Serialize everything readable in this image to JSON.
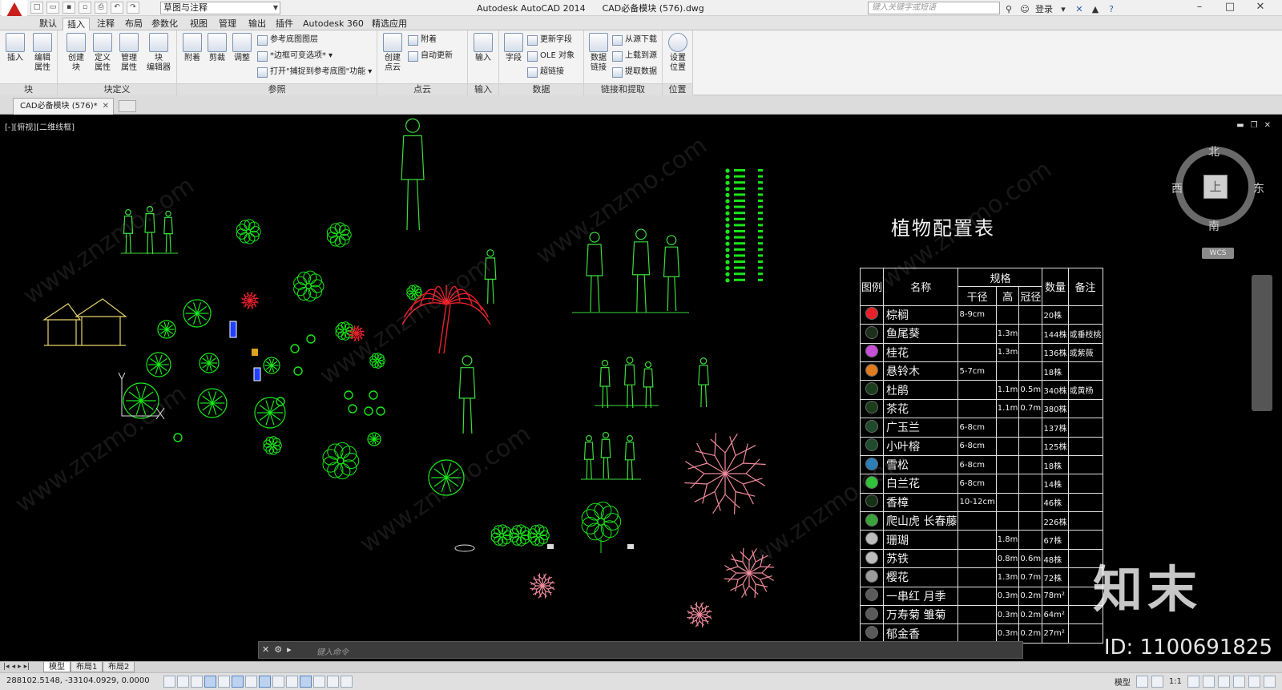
{
  "app": {
    "title": "Autodesk AutoCAD 2014",
    "document": "CAD必备模块 (576).dwg",
    "workspace": "草图与注释",
    "search_placeholder": "键入关键字或短语",
    "login_label": "登录"
  },
  "ribbon_tabs": [
    "默认",
    "插入",
    "注释",
    "布局",
    "参数化",
    "视图",
    "管理",
    "输出",
    "插件",
    "Autodesk 360",
    "精选应用"
  ],
  "active_ribbon_tab": "插入",
  "ribbon": {
    "block": {
      "title": "块",
      "insert": "插入",
      "edit_attr": "编辑\n属性"
    },
    "block_def": {
      "title": "块定义",
      "create": "创建\n块",
      "define_attr": "定义\n属性",
      "manage_attr": "管理\n属性",
      "block_editor": "块\n编辑器"
    },
    "reference": {
      "title": "参照",
      "attach": "附着",
      "clip": "剪裁",
      "adjust": "调整",
      "underlay_layers": "参考底图图层",
      "frames": "*边框可变选项*",
      "snap": "打开\"捕捉到参考底图\"功能"
    },
    "pointcloud": {
      "title": "点云",
      "create": "创建\n点云",
      "attach": "附着",
      "autoupdate": "自动更新"
    },
    "import": {
      "title": "输入",
      "import": "输入"
    },
    "data": {
      "title": "数据",
      "field": "字段",
      "update_fields": "更新字段",
      "ole": "OLE 对象",
      "hyperlink": "超链接"
    },
    "link": {
      "title": "链接和提取",
      "data_link": "数据\n链接",
      "download": "从源下载",
      "upload": "上载到源",
      "extract": "提取数据"
    },
    "location": {
      "title": "位置",
      "set": "设置\n位置"
    }
  },
  "file_tab": "CAD必备模块 (576)*",
  "viewport": {
    "label": "[-][俯视][二维线框]",
    "viewcube": {
      "top": "上",
      "north": "北",
      "south": "南",
      "east": "东",
      "west": "西",
      "wcs": "WCS"
    }
  },
  "plant_table": {
    "title": "植物配置表",
    "headers": {
      "icon": "图例",
      "name": "名称",
      "spec": "规格",
      "dbh": "干径",
      "height": "高",
      "crown": "冠径",
      "qty": "数量",
      "note": "备注"
    },
    "rows": [
      {
        "name": "棕榈",
        "dbh": "8-9cm",
        "h": "",
        "c": "",
        "qty": "20株",
        "note": "",
        "color": "#e8202a"
      },
      {
        "name": "鱼尾葵",
        "dbh": "",
        "h": "1.3m",
        "c": "",
        "qty": "144株",
        "note": "或垂枝桃",
        "color": "#1c2f1c"
      },
      {
        "name": "桂花",
        "dbh": "",
        "h": "1.3m",
        "c": "",
        "qty": "136株",
        "note": "或紫薇",
        "color": "#c94fd8"
      },
      {
        "name": "悬铃木",
        "dbh": "5-7cm",
        "h": "",
        "c": "",
        "qty": "18株",
        "note": "",
        "color": "#e07a1a"
      },
      {
        "name": "杜鹃",
        "dbh": "",
        "h": "1.1m",
        "c": "0.5m",
        "qty": "340株",
        "note": "或黄杨",
        "color": "#1b3d1b"
      },
      {
        "name": "茶花",
        "dbh": "",
        "h": "1.1m",
        "c": "0.7m",
        "qty": "380株",
        "note": "",
        "color": "#1b3d1b"
      },
      {
        "name": "广玉兰",
        "dbh": "6-8cm",
        "h": "",
        "c": "",
        "qty": "137株",
        "note": "",
        "color": "#1f4a2b"
      },
      {
        "name": "小叶榕",
        "dbh": "6-8cm",
        "h": "",
        "c": "",
        "qty": "125株",
        "note": "",
        "color": "#1f4a2b"
      },
      {
        "name": "雪松",
        "dbh": "6-8cm",
        "h": "",
        "c": "",
        "qty": "18株",
        "note": "",
        "color": "#2a7fb9"
      },
      {
        "name": "白兰花",
        "dbh": "6-8cm",
        "h": "",
        "c": "",
        "qty": "14株",
        "note": "",
        "color": "#2fc23a"
      },
      {
        "name": "香樟",
        "dbh": "10-12cm",
        "h": "",
        "c": "",
        "qty": "46株",
        "note": "",
        "color": "#163016"
      },
      {
        "name": "爬山虎 长春藤",
        "dbh": "",
        "h": "",
        "c": "",
        "qty": "226株",
        "note": "",
        "color": "#3aa23a"
      },
      {
        "name": "珊瑚",
        "dbh": "",
        "h": "1.8m",
        "c": "",
        "qty": "67株",
        "note": "",
        "color": "#bdbdbd"
      },
      {
        "name": "苏铁",
        "dbh": "",
        "h": "0.8m",
        "c": "0.6m",
        "qty": "48株",
        "note": "",
        "color": "#bdbdbd"
      },
      {
        "name": "樱花",
        "dbh": "",
        "h": "1.3m",
        "c": "0.7m",
        "qty": "72株",
        "note": "",
        "color": "#9d9d9d"
      },
      {
        "name": "一串红 月季",
        "dbh": "",
        "h": "0.3m",
        "c": "0.2m",
        "qty": "78m²",
        "note": "",
        "color": "#5a5a5a"
      },
      {
        "name": "万寿菊 雏菊",
        "dbh": "",
        "h": "0.3m",
        "c": "0.2m",
        "qty": "64m²",
        "note": "",
        "color": "#5a5a5a"
      },
      {
        "name": "郁金香",
        "dbh": "",
        "h": "0.3m",
        "c": "0.2m",
        "qty": "27m²",
        "note": "",
        "color": "#5a5a5a"
      }
    ]
  },
  "command_line": {
    "placeholder": "键入命令"
  },
  "layout_tabs": [
    "模型",
    "布局1",
    "布局2"
  ],
  "active_layout": "模型",
  "status": {
    "coords": "288102.5148, -33104.0929, 0.0000",
    "model": "模型",
    "scale": "1:1"
  },
  "watermark": {
    "site": "www.znzmo.com",
    "brand": "知末",
    "id": "ID: 1100691825"
  },
  "colors": {
    "plant_green": "#19e619",
    "red_palm": "#e8202a",
    "pink_tree": "#f08a9a",
    "structure_yellow": "#e6d36a",
    "person_green": "#3cdc3c"
  }
}
